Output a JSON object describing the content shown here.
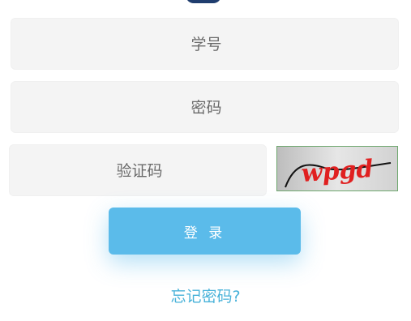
{
  "form": {
    "student_id_placeholder": "学号",
    "password_placeholder": "密码",
    "captcha_placeholder": "验证码",
    "captcha_image_text": "wpgd",
    "login_label": "登 录",
    "forgot_label": "忘记密码?"
  },
  "colors": {
    "button": "#5bbbea",
    "link": "#48b2d9",
    "field_bg": "#f4f4f4",
    "captcha_text": "#e02020"
  }
}
